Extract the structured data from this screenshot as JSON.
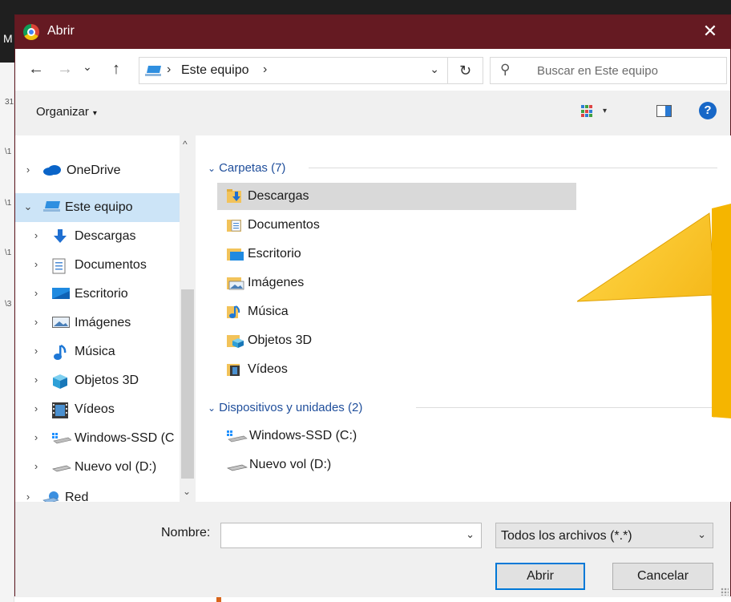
{
  "window": {
    "title": "Abrir",
    "close_glyph": "✕"
  },
  "address_bar": {
    "back_glyph": "←",
    "forward_glyph": "→",
    "recent_glyph": "⌄",
    "up_glyph": "↑",
    "sep_glyph": "›",
    "location": "Este equipo",
    "dropdown_glyph": "⌄",
    "refresh_glyph": "↻"
  },
  "search": {
    "placeholder": "Buscar en Este equipo",
    "icon_glyph": "⚲"
  },
  "toolbar": {
    "organize_label": "Organizar",
    "organize_caret": "▾",
    "view_caret": "▾",
    "help_glyph": "?"
  },
  "nav": {
    "items": [
      {
        "label": "OneDrive",
        "chevron": "›",
        "icon": "onedrive-icon"
      },
      {
        "label": "Este equipo",
        "chevron": "⌄",
        "icon": "computer-icon",
        "selected": true
      },
      {
        "label": "Descargas",
        "chevron": "›",
        "icon": "downloads-icon"
      },
      {
        "label": "Documentos",
        "chevron": "›",
        "icon": "documents-icon"
      },
      {
        "label": "Escritorio",
        "chevron": "›",
        "icon": "desktop-icon"
      },
      {
        "label": "Imágenes",
        "chevron": "›",
        "icon": "pictures-icon"
      },
      {
        "label": "Música",
        "chevron": "›",
        "icon": "music-icon"
      },
      {
        "label": "Objetos 3D",
        "chevron": "›",
        "icon": "objects-3d-icon"
      },
      {
        "label": "Vídeos",
        "chevron": "›",
        "icon": "videos-icon"
      },
      {
        "label": "Windows-SSD (C",
        "chevron": "›",
        "icon": "windows-drive-icon"
      },
      {
        "label": "Nuevo vol (D:)",
        "chevron": "›",
        "icon": "drive-icon"
      },
      {
        "label": "Red",
        "chevron": "›",
        "icon": "network-icon"
      }
    ],
    "scroll_up_glyph": "^",
    "scroll_down_glyph": "⌄"
  },
  "content": {
    "groups": [
      {
        "header": "Carpetas (7)",
        "items": [
          {
            "label": "Descargas",
            "icon": "downloads-folder-icon",
            "selected": true
          },
          {
            "label": "Documentos",
            "icon": "documents-folder-icon"
          },
          {
            "label": "Escritorio",
            "icon": "desktop-folder-icon"
          },
          {
            "label": "Imágenes",
            "icon": "pictures-folder-icon"
          },
          {
            "label": "Música",
            "icon": "music-folder-icon"
          },
          {
            "label": "Objetos 3D",
            "icon": "objects-3d-folder-icon"
          },
          {
            "label": "Vídeos",
            "icon": "videos-folder-icon"
          }
        ]
      },
      {
        "header": "Dispositivos y unidades (2)",
        "items": [
          {
            "label": "Windows-SSD (C:)",
            "icon": "windows-drive-icon"
          },
          {
            "label": "Nuevo vol (D:)",
            "icon": "drive-icon"
          }
        ]
      }
    ],
    "group_chevron": "⌄"
  },
  "bottom": {
    "name_label": "Nombre:",
    "name_value": "",
    "name_dropdown_glyph": "⌄",
    "filter_value": "Todos los archivos (*.*)",
    "filter_dropdown_glyph": "⌄",
    "open_label": "Abrir",
    "cancel_label": "Cancelar"
  },
  "background": {
    "left_edge_fragments": [
      "31",
      "\\1",
      "\\1",
      "\\1",
      "\\3"
    ],
    "top_fragment": "M"
  },
  "colors": {
    "titlebar": "#651a22",
    "selection": "#cce4f7",
    "group_header": "#1f4e9b",
    "accent": "#0078d7",
    "callout": "#f6b800"
  }
}
